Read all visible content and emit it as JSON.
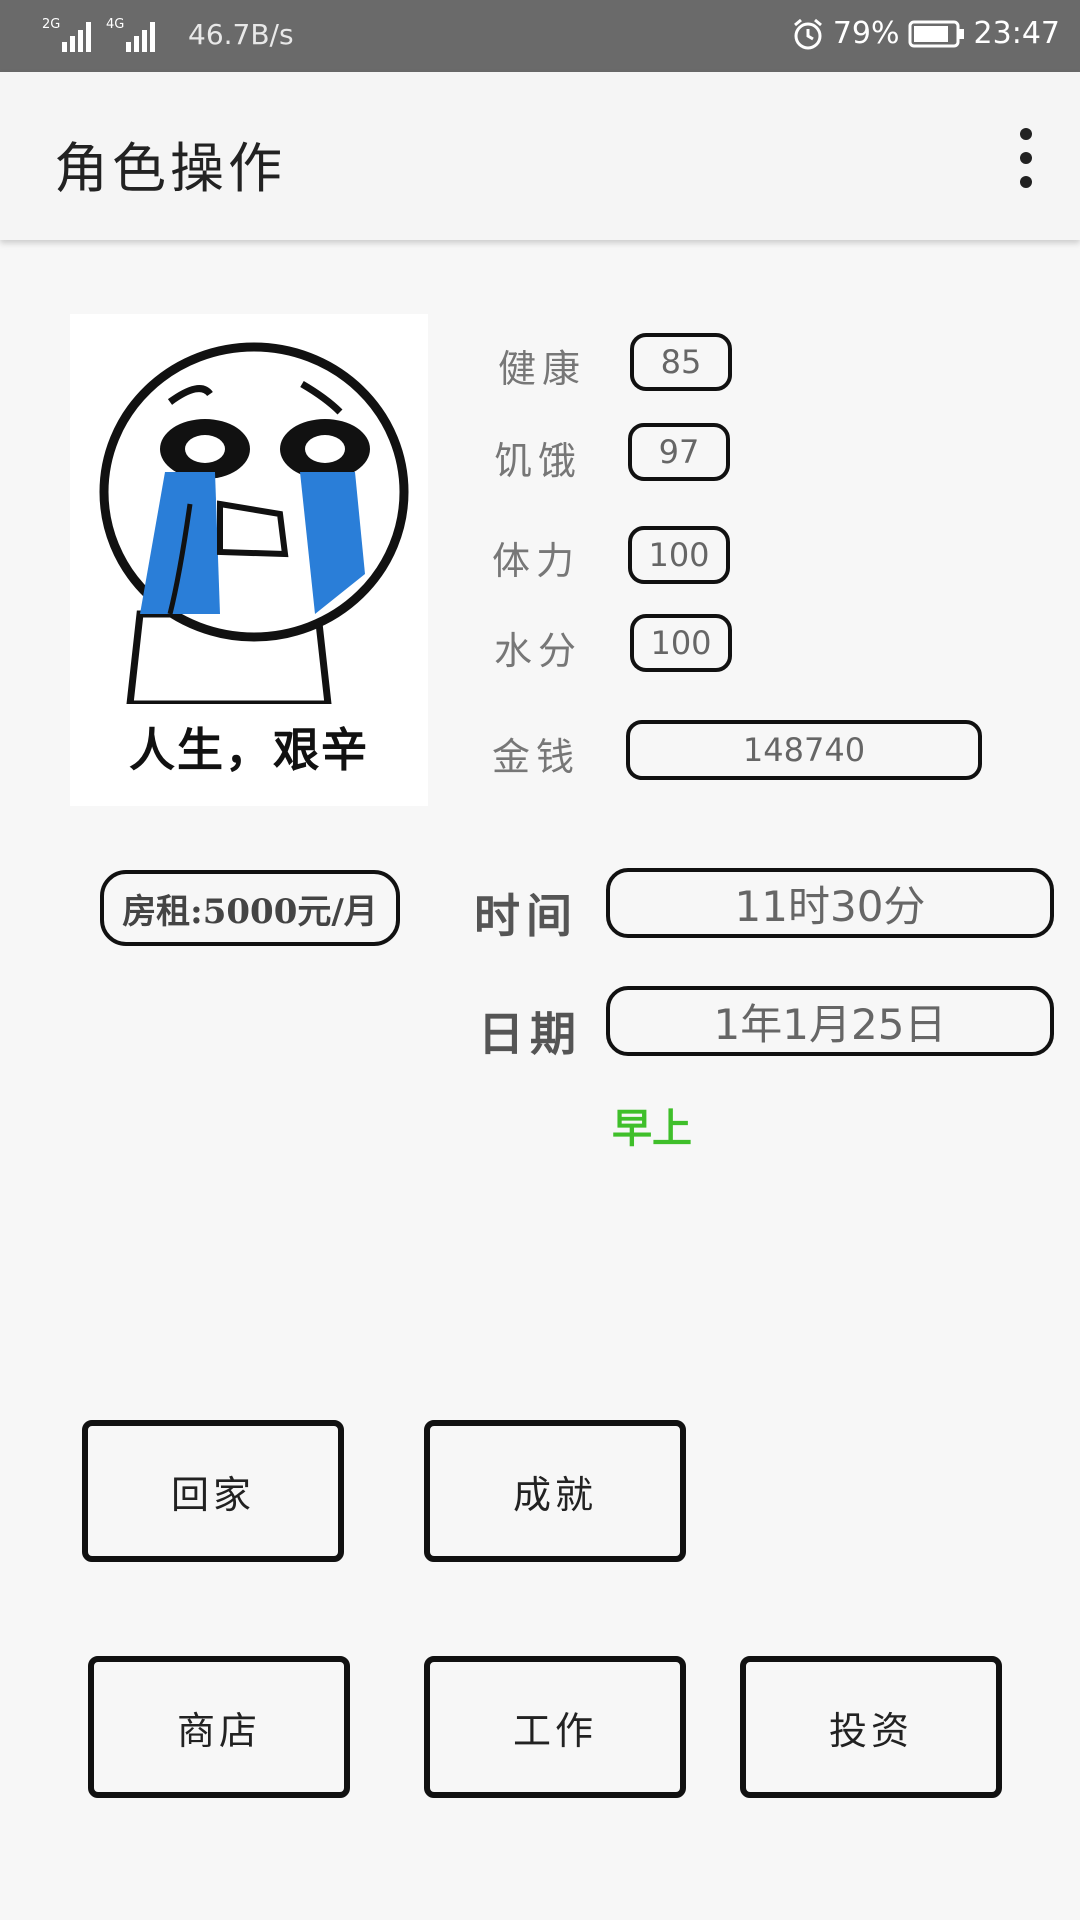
{
  "status_bar": {
    "signal1": "2G",
    "signal2": "4G",
    "speed": "46.7B/s",
    "battery": "79%",
    "time": "23:47"
  },
  "app_bar": {
    "title": "角色操作",
    "overflow_icon": "more-vert-icon"
  },
  "avatar": {
    "caption": "人生，艰辛"
  },
  "stats": [
    {
      "label": "健康",
      "value": "85"
    },
    {
      "label": "饥饿",
      "value": "97"
    },
    {
      "label": "体力",
      "value": "100"
    },
    {
      "label": "水分",
      "value": "100"
    }
  ],
  "money": {
    "label": "金钱",
    "value": "148740"
  },
  "rent": {
    "text": "房租:5000元/月"
  },
  "time": {
    "label": "时间",
    "value": "11时30分"
  },
  "date": {
    "label": "日期",
    "value": "1年1月25日"
  },
  "period": {
    "text": "早上",
    "color": "#3fbf2a"
  },
  "actions": {
    "home": "回家",
    "achievement": "成就",
    "shop": "商店",
    "work": "工作",
    "invest": "投资"
  }
}
